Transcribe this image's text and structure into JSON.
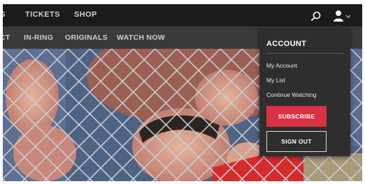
{
  "topnav": {
    "items": [
      "S",
      "TICKETS",
      "SHOP"
    ]
  },
  "subnav": {
    "items": [
      "CT",
      "IN-RING",
      "ORIGINALS",
      "WATCH NOW"
    ]
  },
  "account_menu": {
    "title": "ACCOUNT",
    "links": [
      "My Account",
      "My List",
      "Continue Watching"
    ],
    "subscribe_label": "SUBSCRIBE",
    "signout_label": "SIGN OUT"
  },
  "colors": {
    "topbar": "#1b1b1b",
    "subnav": "#3a3a3a",
    "dropdown": "#2e2e2e",
    "subscribe": "#d93244"
  }
}
